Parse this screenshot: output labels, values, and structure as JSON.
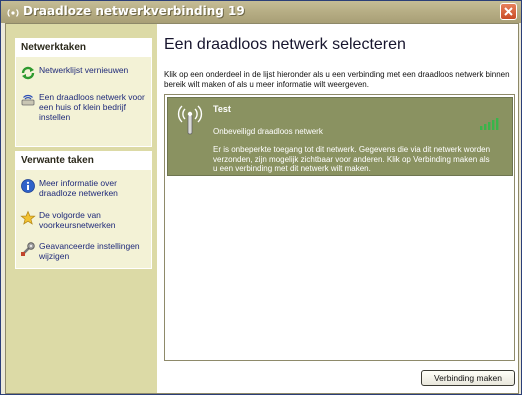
{
  "window": {
    "title": "Draadloze netwerkverbinding 19"
  },
  "sidebar": {
    "network_tasks": {
      "title": "Netwerktaken",
      "items": [
        {
          "label": "Netwerklijst vernieuwen",
          "icon": "refresh-icon"
        },
        {
          "label": "Een draadloos netwerk voor een huis of klein bedrijf instellen",
          "icon": "network-setup-icon"
        }
      ]
    },
    "related_tasks": {
      "title": "Verwante taken",
      "items": [
        {
          "label": "Meer informatie over draadloze netwerken",
          "icon": "info-icon"
        },
        {
          "label": "De volgorde van voorkeursnetwerken",
          "icon": "star-icon"
        },
        {
          "label": "Geavanceerde instellingen wijzigen",
          "icon": "advanced-settings-icon"
        }
      ]
    }
  },
  "main": {
    "title": "Een draadloos netwerk selecteren",
    "description": "Klik op een onderdeel in de lijst hieronder als u een verbinding met een draadloos netwerk binnen bereik wilt maken of als u meer informatie wilt weergeven.",
    "networks": [
      {
        "name": "Test",
        "status": "Onbeveiligd draadloos netwerk",
        "description": "Er is onbeperkte toegang tot dit netwerk. Gegevens die via dit netwerk worden verzonden, zijn mogelijk zichtbaar voor anderen. Klik op Verbinding maken als u een verbinding met dit netwerk wilt maken.",
        "signal_bars": 5,
        "icon": "wireless-antenna-icon"
      }
    ],
    "connect_button": "Verbinding maken"
  },
  "colors": {
    "selected_network_bg": "#8a9261",
    "sidebar_bg": "#dcdaa6",
    "link_text": "#1f2a7a",
    "signal": "#39b54a"
  }
}
